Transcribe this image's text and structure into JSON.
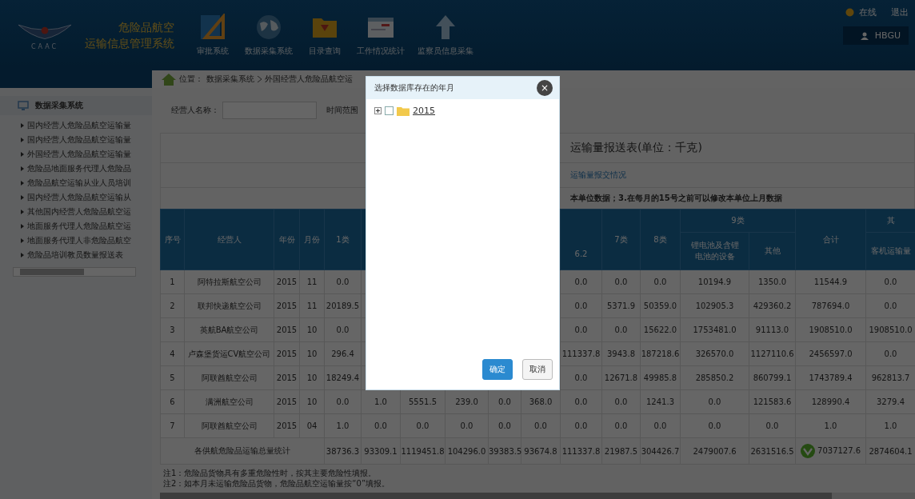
{
  "header": {
    "logo_text": "CAAC",
    "title_lines": [
      "危险品航空",
      "运输信息管理系统"
    ],
    "nav": [
      {
        "kind": "ruler",
        "label": "审批系统"
      },
      {
        "kind": "globe",
        "label": "数据采集系统"
      },
      {
        "kind": "folder",
        "label": "目录查询"
      },
      {
        "kind": "window",
        "label": "工作情况统计"
      },
      {
        "kind": "upload",
        "label": "监察员信息采集"
      }
    ],
    "status": "在线",
    "logout": "退出",
    "user": "HBGU"
  },
  "breadcrumb": {
    "prefix": "位置：",
    "items": [
      "数据采集系统",
      "外国经营人危险品航空运"
    ]
  },
  "sidebar": {
    "title": "数据采集系统",
    "items": [
      "国内经营人危险品航空运输量",
      "国内经营人危险品航空运输量",
      "外国经营人危险品航空运输量",
      "危险品地面服务代理人危险品",
      "危险品航空运输从业人员培训",
      "国内经营人危险品航空运输从",
      "其他国内经营人危险品航空运",
      "地面服务代理人危险品航空运",
      "地面服务代理人非危险品航空",
      "危险品培训教员数量报送表"
    ]
  },
  "filters": {
    "operator_label": "经营人名称：",
    "time_label": "时间范围"
  },
  "report": {
    "title": "运输量报送表(单位：千克)",
    "link": "运输量报交情况",
    "note": "本单位数据；3.在每月的15号之前可以修改本单位上月数据"
  },
  "table": {
    "columns": [
      {
        "kind": "single",
        "label": "序号"
      },
      {
        "kind": "single",
        "label": "经营人"
      },
      {
        "kind": "single",
        "label": "年份"
      },
      {
        "kind": "single",
        "label": "月份"
      },
      {
        "kind": "single",
        "label": "1类"
      },
      {
        "kind": "hidden"
      },
      {
        "kind": "hidden"
      },
      {
        "kind": "hidden"
      },
      {
        "kind": "hidden"
      },
      {
        "kind": "hidden"
      },
      {
        "kind": "low",
        "label": "6.2"
      },
      {
        "kind": "single",
        "label": "7类"
      },
      {
        "kind": "single",
        "label": "8类"
      },
      {
        "kind": "sub",
        "starts_group": true,
        "label": "锂电池及含锂电池的设备"
      },
      {
        "kind": "sub",
        "starts_group": false,
        "label": "其他"
      },
      {
        "kind": "single",
        "label": "合计"
      },
      {
        "kind": "sub",
        "starts_group": true,
        "label": "客机运输量"
      }
    ],
    "column_groups": [
      "9类",
      "其"
    ],
    "rows": [
      [
        "1",
        "阿特拉斯航空公司",
        "2015",
        "11",
        "0.0",
        null,
        null,
        null,
        null,
        null,
        "0.0",
        "0.0",
        "0.0",
        "10194.9",
        "1350.0",
        "11544.9",
        "0.0"
      ],
      [
        "2",
        "联邦快递航空公司",
        "2015",
        "11",
        "20189.5",
        null,
        null,
        null,
        null,
        null,
        "0.0",
        "5371.9",
        "50359.0",
        "102905.3",
        "429360.2",
        "787694.0",
        "0.0"
      ],
      [
        "3",
        "英航BA航空公司",
        "2015",
        "10",
        "0.0",
        null,
        null,
        null,
        null,
        null,
        "0.0",
        "0.0",
        "15622.0",
        "1753481.0",
        "91113.0",
        "1908510.0",
        "1908510.0"
      ],
      [
        "4",
        "卢森堡货运CV航空公司",
        "2015",
        "10",
        "296.4",
        null,
        null,
        null,
        null,
        null,
        "111337.8",
        "3943.8",
        "187218.6",
        "326570.0",
        "1127110.6",
        "2456597.0",
        "0.0"
      ],
      [
        "5",
        "阿联酋航空公司",
        "2015",
        "10",
        "18249.4",
        null,
        null,
        null,
        null,
        null,
        "0.0",
        "12671.8",
        "49985.8",
        "285850.2",
        "860799.1",
        "1743789.4",
        "962813.7"
      ],
      [
        "6",
        "满洲航空公司",
        "2015",
        "10",
        "0.0",
        "1.0",
        "5551.5",
        "239.0",
        "0.0",
        "368.0",
        "0.0",
        "0.0",
        "1241.3",
        "0.0",
        "121583.6",
        "128990.4",
        "3279.4"
      ],
      [
        "7",
        "阿联酋航空公司",
        "2015",
        "04",
        "1.0",
        "0.0",
        "0.0",
        "0.0",
        "0.0",
        "0.0",
        "0.0",
        "0.0",
        "0.0",
        "0.0",
        "0.0",
        "1.0",
        "1.0"
      ]
    ],
    "total": {
      "label": "各供航危险品运输总量统计",
      "values": [
        "38736.3",
        "93309.1",
        "1119451.8",
        "104296.0",
        "39383.5",
        "93674.8",
        "111337.8",
        "21987.5",
        "304426.7",
        "2479007.6",
        "2631516.5",
        "7037127.6",
        "2874604.1"
      ],
      "sum_flagged": true
    }
  },
  "notes": [
    "注1：危险品货物具有多重危险性时，按其主要危险性填报。",
    "注2：如本月未运输危险品货物，危险品航空运输量按“0”填报。"
  ],
  "dialog": {
    "title": "选择数据库存在的年月",
    "close": "×",
    "tree": [
      {
        "label": "2015",
        "expanded": false,
        "checked": false
      }
    ],
    "buttons": [
      {
        "kind": "primary",
        "label": "确定"
      },
      {
        "kind": "secondary",
        "label": "取消"
      }
    ]
  }
}
